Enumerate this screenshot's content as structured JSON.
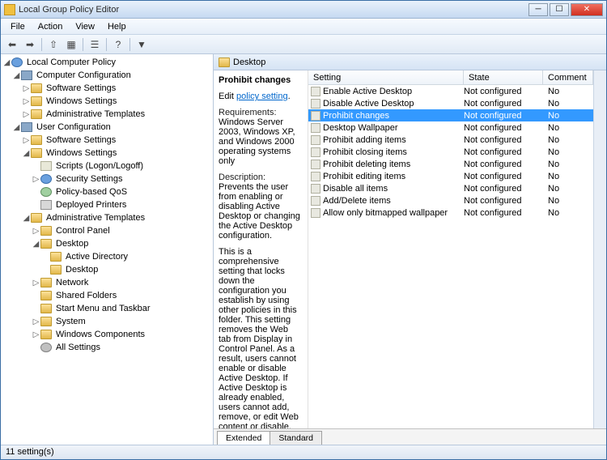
{
  "window": {
    "title": "Local Group Policy Editor"
  },
  "menu": {
    "file": "File",
    "action": "Action",
    "view": "View",
    "help": "Help"
  },
  "tree": {
    "root": "Local Computer Policy",
    "cc": "Computer Configuration",
    "cc_ss": "Software Settings",
    "cc_ws": "Windows Settings",
    "cc_at": "Administrative Templates",
    "uc": "User Configuration",
    "uc_ss": "Software Settings",
    "uc_ws": "Windows Settings",
    "uc_ws_scripts": "Scripts (Logon/Logoff)",
    "uc_ws_sec": "Security Settings",
    "uc_ws_qos": "Policy-based QoS",
    "uc_ws_prn": "Deployed Printers",
    "uc_at": "Administrative Templates",
    "uc_at_cp": "Control Panel",
    "uc_at_dt": "Desktop",
    "uc_at_dt_ad": "Active Directory",
    "uc_at_dt_dt": "Desktop",
    "uc_at_net": "Network",
    "uc_at_sf": "Shared Folders",
    "uc_at_smt": "Start Menu and Taskbar",
    "uc_at_sys": "System",
    "uc_at_wc": "Windows Components",
    "uc_at_all": "All Settings"
  },
  "path": {
    "label": "Desktop"
  },
  "desc": {
    "title": "Prohibit changes",
    "edit": "Edit ",
    "link": "policy setting",
    "req_h": "Requirements:",
    "req_t": "Windows Server 2003, Windows XP, and Windows 2000 operating systems only",
    "d_h": "Description:",
    "d1": "Prevents the user from enabling or disabling Active Desktop or changing the Active Desktop configuration.",
    "d2": "This is a comprehensive setting that locks down the configuration you establish by using other policies in this folder. This setting removes the Web tab from Display in Control Panel. As a result, users cannot enable or disable Active Desktop. If Active Desktop is already enabled, users cannot add, remove, or edit Web content or disable, lock, or synchronize Active Desktop components."
  },
  "cols": {
    "setting": "Setting",
    "state": "State",
    "comment": "Comment"
  },
  "settings": [
    {
      "s": "Enable Active Desktop",
      "st": "Not configured",
      "c": "No"
    },
    {
      "s": "Disable Active Desktop",
      "st": "Not configured",
      "c": "No"
    },
    {
      "s": "Prohibit changes",
      "st": "Not configured",
      "c": "No",
      "sel": true
    },
    {
      "s": "Desktop Wallpaper",
      "st": "Not configured",
      "c": "No"
    },
    {
      "s": "Prohibit adding items",
      "st": "Not configured",
      "c": "No"
    },
    {
      "s": "Prohibit closing items",
      "st": "Not configured",
      "c": "No"
    },
    {
      "s": "Prohibit deleting items",
      "st": "Not configured",
      "c": "No"
    },
    {
      "s": "Prohibit editing items",
      "st": "Not configured",
      "c": "No"
    },
    {
      "s": "Disable all items",
      "st": "Not configured",
      "c": "No"
    },
    {
      "s": "Add/Delete items",
      "st": "Not configured",
      "c": "No"
    },
    {
      "s": "Allow only bitmapped wallpaper",
      "st": "Not configured",
      "c": "No"
    }
  ],
  "tabs": {
    "ext": "Extended",
    "std": "Standard"
  },
  "status": {
    "text": "11 setting(s)"
  }
}
